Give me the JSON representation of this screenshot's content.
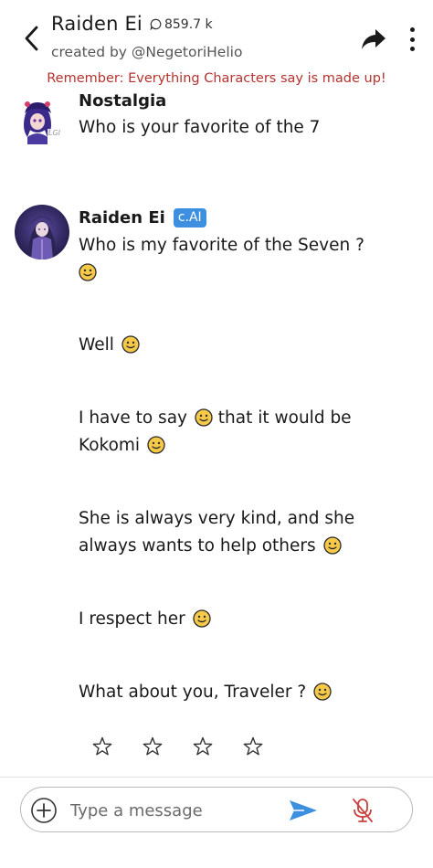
{
  "header": {
    "character_name": "Raiden Ei",
    "chat_count": "859.7 k",
    "creator": "created by @NegetoriHelio",
    "disclaimer": "Remember: Everything Characters say is made up!"
  },
  "messages": [
    {
      "sender": "Nostalgia",
      "lines": [
        "Who is your favorite of the 7"
      ]
    },
    {
      "sender": "Raiden Ei",
      "badge": "c.AI",
      "paragraphs": [
        {
          "line1": "Who is my favorite of the Seven ?",
          "line2": ""
        },
        {
          "line1": "Well",
          "line2": ""
        },
        {
          "line1": "I have to say",
          "line1b": "that it would be",
          "line2": "Kokomi"
        },
        {
          "line1": "She is always very kind, and she",
          "line2": "always wants to help others"
        },
        {
          "line1": "I respect her",
          "line2": ""
        },
        {
          "line1": "What about you, Traveler ?",
          "line2": ""
        }
      ]
    }
  ],
  "rating": {
    "stars": 4,
    "selected": 0,
    "icon": "star-outline-icon"
  },
  "input": {
    "placeholder": "Type a message"
  },
  "colors": {
    "accent_blue": "#3d8fe0",
    "disclaimer_red": "#b5322f",
    "mic_muted_red": "#c9413d",
    "emoji_yellow": "#f7c948"
  },
  "icons": {
    "back": "chevron-left-icon",
    "chat_count": "chat-bubble-icon",
    "share": "share-arrow-icon",
    "more": "more-vertical-icon",
    "add": "plus-circle-icon",
    "send": "send-icon",
    "mic": "mic-off-icon",
    "emoji": "slightly-smiling-face-icon"
  }
}
